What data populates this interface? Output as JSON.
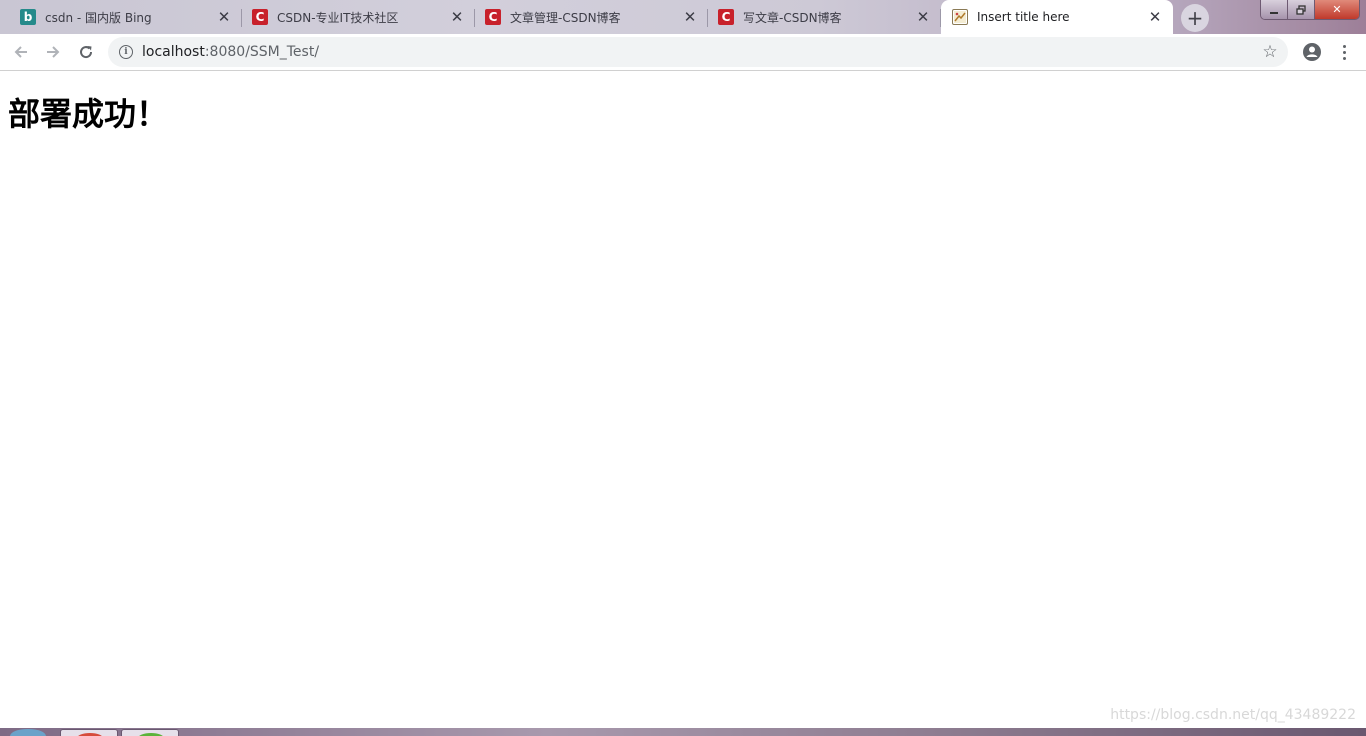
{
  "browser": {
    "tabs": [
      {
        "title": "csdn - 国内版 Bing",
        "favicon": "bing-icon",
        "favicon_glyph": "b",
        "active": false
      },
      {
        "title": "CSDN-专业IT技术社区",
        "favicon": "csdn-icon",
        "favicon_glyph": "C",
        "active": false
      },
      {
        "title": "文章管理-CSDN博客",
        "favicon": "csdn-icon",
        "favicon_glyph": "C",
        "active": false
      },
      {
        "title": "写文章-CSDN博客",
        "favicon": "csdn-icon",
        "favicon_glyph": "C",
        "active": false
      },
      {
        "title": "Insert title here",
        "favicon": "page-icon",
        "favicon_glyph": "",
        "active": true
      }
    ],
    "address_bar": {
      "host": "localhost",
      "path": ":8080/SSM_Test/"
    }
  },
  "page": {
    "heading": "部署成功！"
  },
  "watermark": "https://blog.csdn.net/qq_43489222",
  "colors": {
    "csdn_red": "#c8212b",
    "bing_teal": "#258a8a"
  }
}
